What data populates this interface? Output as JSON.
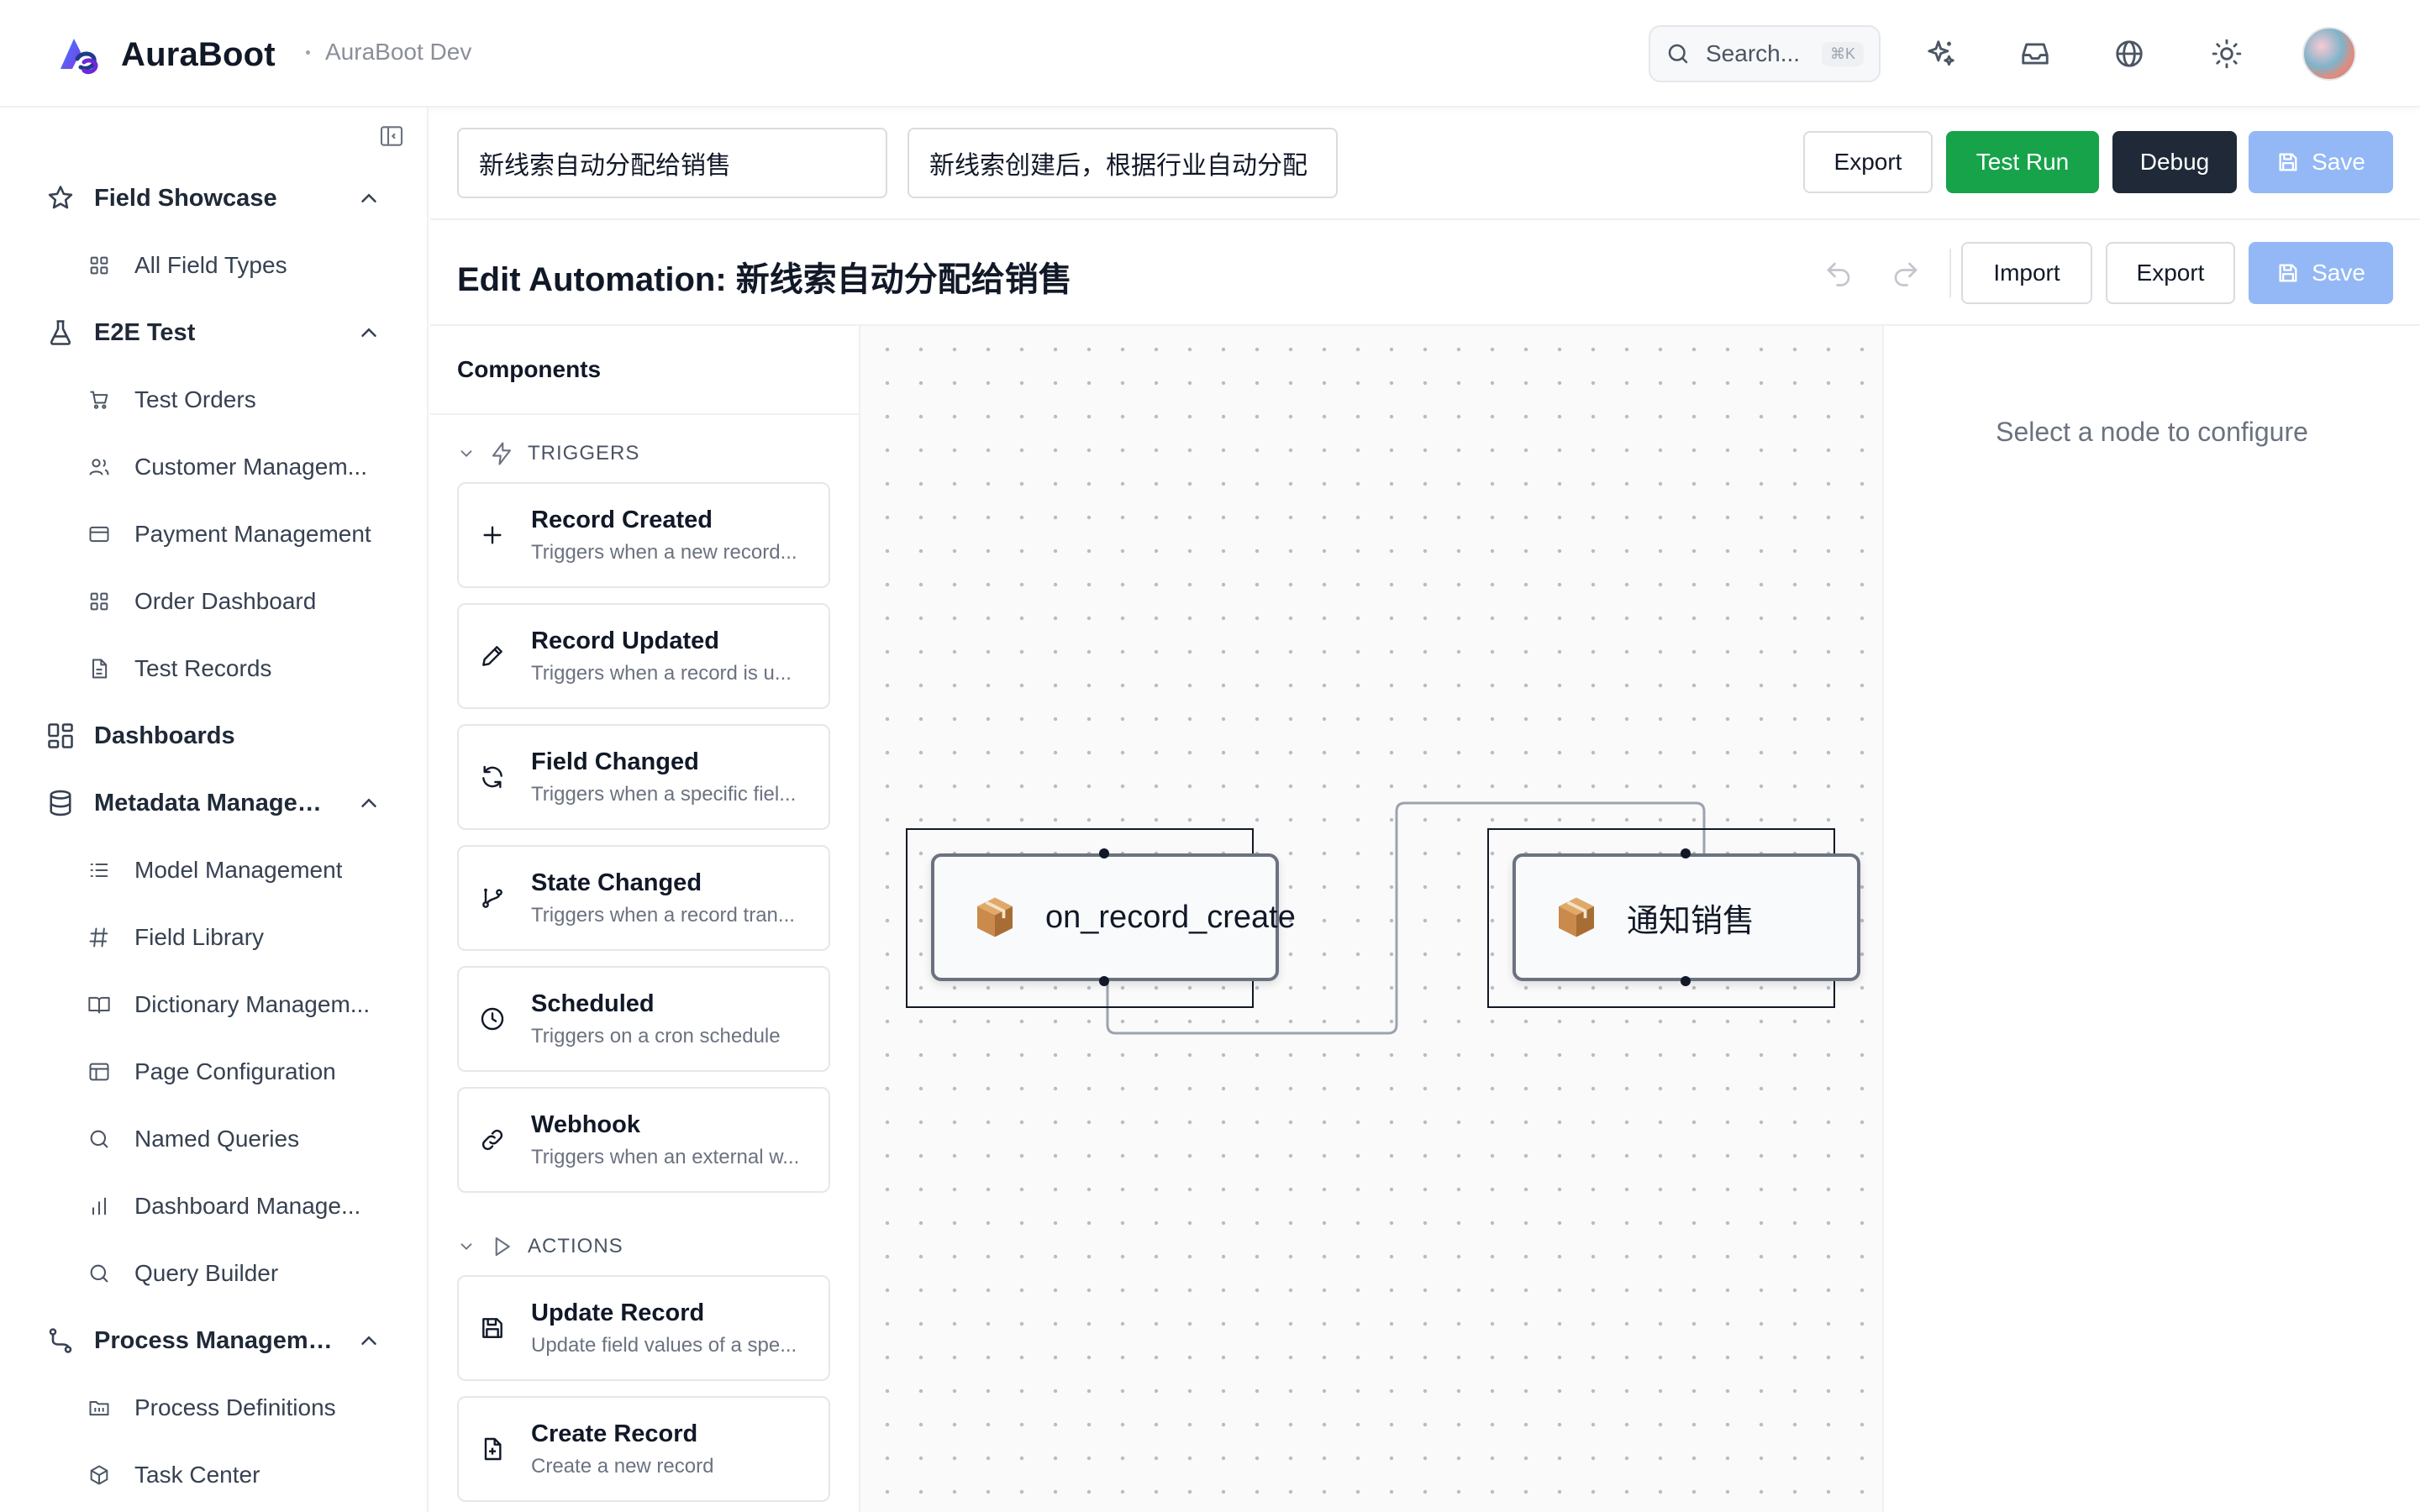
{
  "header": {
    "brand_name": "AuraBoot",
    "environment": "AuraBoot Dev",
    "search_placeholder": "Search...",
    "search_shortcut": "⌘K",
    "icons": [
      "sparkles-icon",
      "inbox-icon",
      "globe-icon",
      "sun-icon"
    ]
  },
  "sidebar": {
    "groups": [
      {
        "label": "Field Showcase",
        "icon": "star-icon",
        "items": [
          {
            "label": "All Field Types",
            "icon": "grid-icon"
          }
        ]
      },
      {
        "label": "E2E Test",
        "icon": "flask-icon",
        "items": [
          {
            "label": "Test Orders",
            "icon": "cart-icon"
          },
          {
            "label": "Customer Managem...",
            "icon": "users-icon"
          },
          {
            "label": "Payment Management",
            "icon": "credit-card-icon"
          },
          {
            "label": "Order Dashboard",
            "icon": "grid-icon"
          },
          {
            "label": "Test Records",
            "icon": "file-icon"
          }
        ]
      },
      {
        "label": "Dashboards",
        "icon": "dashboard-icon",
        "items": []
      },
      {
        "label": "Metadata Managem...",
        "icon": "database-icon",
        "items": [
          {
            "label": "Model Management",
            "icon": "list-icon"
          },
          {
            "label": "Field Library",
            "icon": "hash-icon"
          },
          {
            "label": "Dictionary Managem...",
            "icon": "book-icon"
          },
          {
            "label": "Page Configuration",
            "icon": "layout-icon"
          },
          {
            "label": "Named Queries",
            "icon": "search-icon"
          },
          {
            "label": "Dashboard Manage...",
            "icon": "bar-chart-icon"
          },
          {
            "label": "Query Builder",
            "icon": "search-icon"
          }
        ]
      },
      {
        "label": "Process Management",
        "icon": "workflow-icon",
        "items": [
          {
            "label": "Process Definitions",
            "icon": "folder-icon"
          },
          {
            "label": "Task Center",
            "icon": "box-icon"
          }
        ]
      }
    ]
  },
  "toolbar": {
    "name_value": "新线索自动分配给销售",
    "description_value": "新线索创建后，根据行业自动分配",
    "export_label": "Export",
    "test_run_label": "Test Run",
    "debug_label": "Debug",
    "save_label": "Save"
  },
  "editor": {
    "title": "Edit Automation: 新线索自动分配给销售",
    "import_label": "Import",
    "export_label": "Export",
    "save_label": "Save"
  },
  "components": {
    "title": "Components",
    "triggers_label": "TRIGGERS",
    "triggers": [
      {
        "title": "Record Created",
        "desc": "Triggers when a new record...",
        "icon": "plus-icon"
      },
      {
        "title": "Record Updated",
        "desc": "Triggers when a record is u...",
        "icon": "pencil-icon"
      },
      {
        "title": "Field Changed",
        "desc": "Triggers when a specific fiel...",
        "icon": "refresh-icon"
      },
      {
        "title": "State Changed",
        "desc": "Triggers when a record tran...",
        "icon": "git-branch-icon"
      },
      {
        "title": "Scheduled",
        "desc": "Triggers on a cron schedule",
        "icon": "clock-icon"
      },
      {
        "title": "Webhook",
        "desc": "Triggers when an external w...",
        "icon": "link-icon"
      }
    ],
    "actions_label": "ACTIONS",
    "actions": [
      {
        "title": "Update Record",
        "desc": "Update field values of a spe...",
        "icon": "save-icon"
      },
      {
        "title": "Create Record",
        "desc": "Create a new record",
        "icon": "file-plus-icon"
      }
    ]
  },
  "canvas": {
    "nodes": [
      {
        "label": "on_record_create",
        "icon": "package-icon"
      },
      {
        "label": "通知销售",
        "icon": "package-icon"
      }
    ]
  },
  "config": {
    "placeholder": "Select a node to configure"
  },
  "colors": {
    "green": "#16a34a",
    "dark": "#1f2937",
    "blue_disabled": "#93b8f5"
  }
}
